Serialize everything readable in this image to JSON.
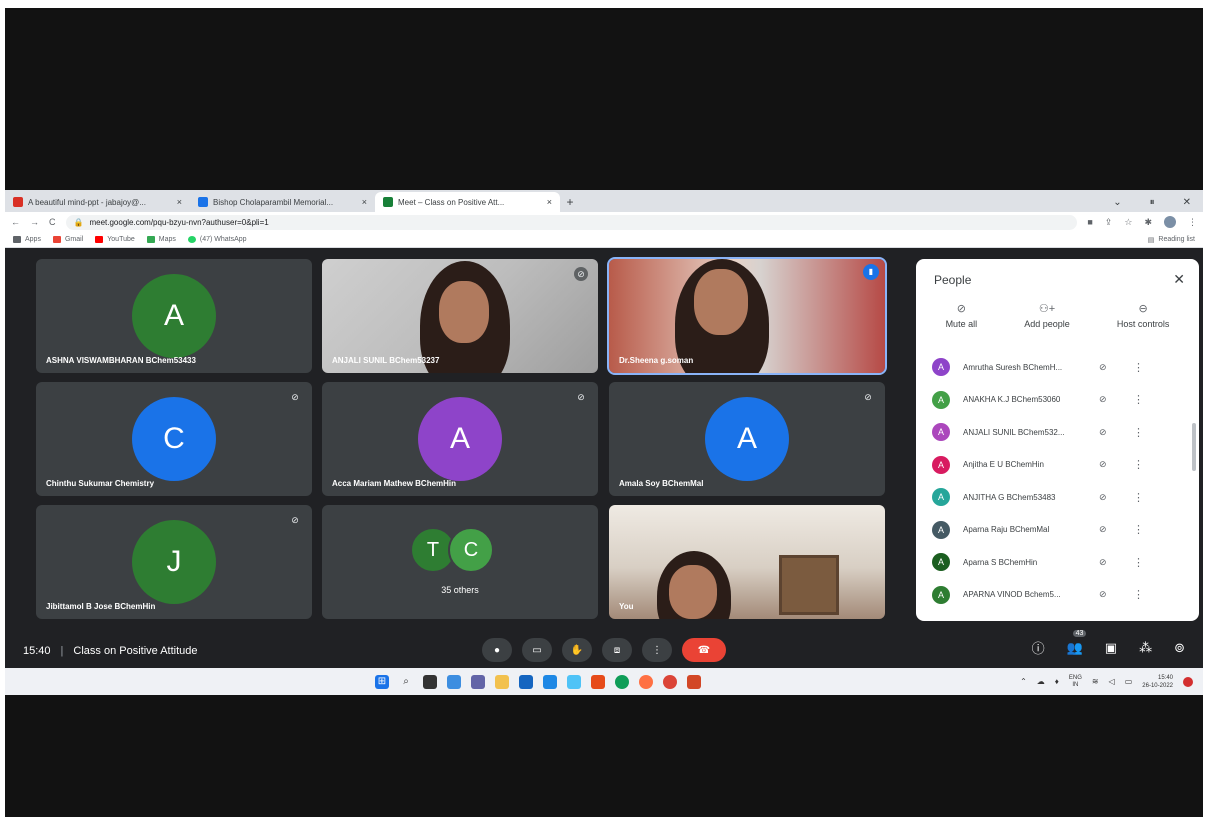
{
  "browser": {
    "tabs": [
      {
        "title": "A beautiful mind-ppt - jabajoy@...",
        "close": "×",
        "color": "#d93025",
        "active": false
      },
      {
        "title": "Bishop Cholaparambil Memorial...",
        "close": "×",
        "color": "#1a73e8",
        "active": false
      },
      {
        "title": "Meet – Class on Positive Att...",
        "close": "×",
        "color": "#188038",
        "active": true
      }
    ],
    "new_tab": "+",
    "window_controls": [
      "⌄",
      "⏸",
      "✕"
    ],
    "url": "meet.google.com/pqu-bzyu-nvn?authuser=0&pli=1",
    "nav": {
      "back": "←",
      "forward": "→",
      "reload": "C"
    },
    "bookmarks": [
      {
        "label": "Apps",
        "color": "#5f6368"
      },
      {
        "label": "Gmail",
        "color": "#ea4335"
      },
      {
        "label": "YouTube",
        "color": "#ff0000"
      },
      {
        "label": "Maps",
        "color": "#34a853"
      },
      {
        "label": "(47) WhatsApp",
        "color": "#25d366"
      }
    ],
    "reading_list": "Reading list"
  },
  "tiles": [
    {
      "name": "ASHNA VISWAMBHARAN BChem53433",
      "initial": "A",
      "color": "#2e7d32",
      "muted": false
    },
    {
      "name": "ANJALI SUNIL BChem53237",
      "video": true,
      "muted": true
    },
    {
      "name": "Dr.Sheena g.soman",
      "video": true,
      "speaking": true
    },
    {
      "name": "Chinthu Sukumar Chemistry",
      "initial": "C",
      "color": "#1a73e8",
      "muted": true
    },
    {
      "name": "Acca Mariam Mathew BChemHin",
      "initial": "A",
      "color": "#8e44c9",
      "muted": true
    },
    {
      "name": "Amala Soy BChemMal",
      "initial": "A",
      "color": "#1a73e8",
      "muted": true
    },
    {
      "name": "Jibittamol B Jose BChemHin",
      "initial": "J",
      "color": "#2e7d32",
      "muted": true
    },
    {
      "name": "35 others",
      "stack": [
        {
          "initial": "T",
          "color": "#2e7d32"
        },
        {
          "initial": "C",
          "color": "#43a047"
        }
      ]
    },
    {
      "name": "You",
      "video": true
    }
  ],
  "people_panel": {
    "title": "People",
    "close": "✕",
    "actions": [
      {
        "label": "Mute all",
        "icon": "mic-off-icon"
      },
      {
        "label": "Add people",
        "icon": "add-person-icon"
      },
      {
        "label": "Host controls",
        "icon": "lock-icon"
      }
    ],
    "participants": [
      {
        "name": "Amrutha Suresh BChemH...",
        "initial": "A",
        "color": "#8e44c9"
      },
      {
        "name": "ANAKHA K.J BChem53060",
        "initial": "A",
        "color": "#43a047"
      },
      {
        "name": "ANJALI SUNIL BChem532...",
        "initial": "A",
        "color": "#ab47bc"
      },
      {
        "name": "Anjitha E U BChemHin",
        "initial": "A",
        "color": "#d81b60"
      },
      {
        "name": "ANJITHA G BChem53483",
        "initial": "A",
        "color": "#26a69a"
      },
      {
        "name": "Aparna Raju BChemMal",
        "initial": "A",
        "color": "#455a64"
      },
      {
        "name": "Aparna S BChemHin",
        "initial": "A",
        "color": "#1b5e20"
      },
      {
        "name": "APARNA VINOD Bchem5...",
        "initial": "A",
        "color": "#2e7d32"
      }
    ]
  },
  "bottom_bar": {
    "time": "15:40",
    "separator": "|",
    "meeting_name": "Class on Positive Attitude",
    "people_count": "43"
  },
  "taskbar": {
    "lang": "ENG",
    "region": "IN",
    "clock_time": "15:40",
    "clock_date": "26-10-2022"
  }
}
